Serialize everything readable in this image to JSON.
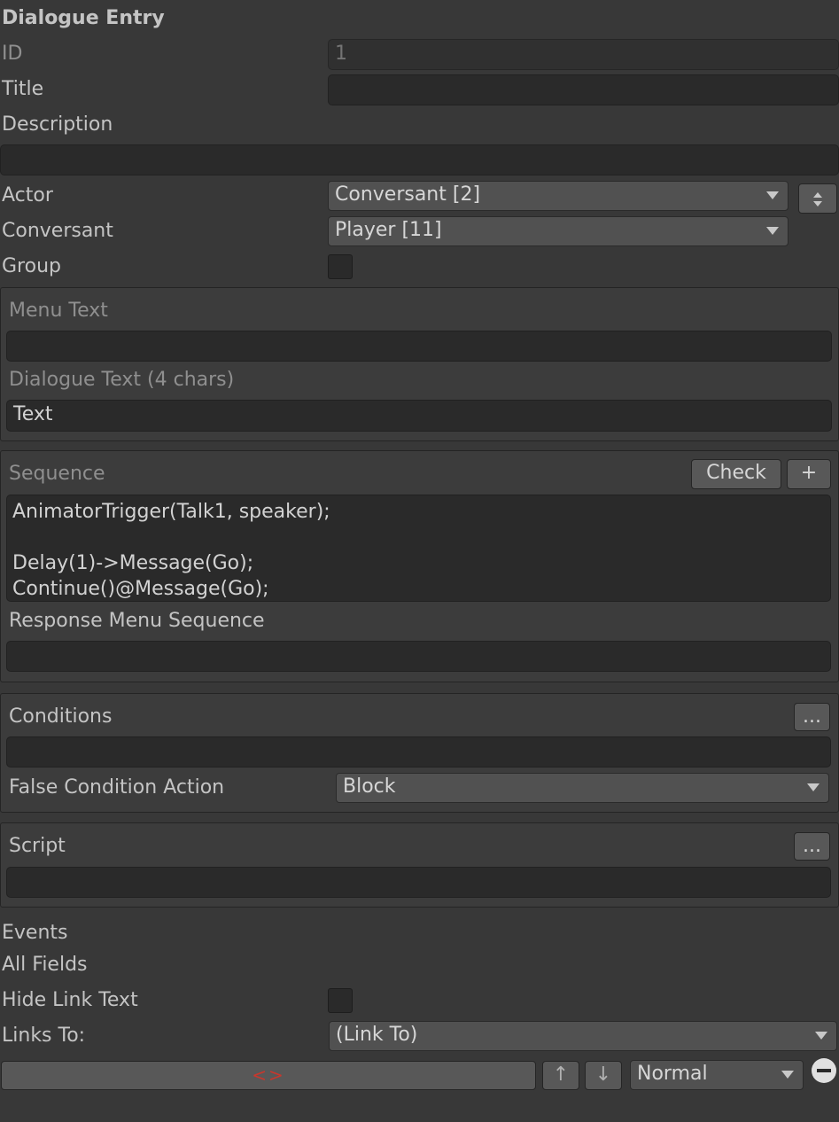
{
  "header": {
    "title": "Dialogue Entry"
  },
  "fields": {
    "id_label": "ID",
    "id_value": "1",
    "title_label": "Title",
    "title_value": "",
    "description_label": "Description",
    "description_value": "",
    "actor_label": "Actor",
    "actor_value": "Conversant [2]",
    "conversant_label": "Conversant",
    "conversant_value": "Player [11]",
    "group_label": "Group",
    "group_checked": false
  },
  "text_panel": {
    "menu_text_label": "Menu Text",
    "menu_text_value": "",
    "dialogue_text_label": "Dialogue Text (4 chars)",
    "dialogue_text_value": "Text"
  },
  "sequence_panel": {
    "sequence_label": "Sequence",
    "check_label": "Check",
    "add_label": "+",
    "sequence_value": "AnimatorTrigger(Talk1, speaker);\n\nDelay(1)->Message(Go);\nContinue()@Message(Go);",
    "response_menu_label": "Response Menu Sequence",
    "response_menu_value": ""
  },
  "conditions_panel": {
    "conditions_label": "Conditions",
    "more_label": "...",
    "conditions_value": "",
    "false_action_label": "False Condition Action",
    "false_action_value": "Block"
  },
  "script_panel": {
    "script_label": "Script",
    "more_label": "...",
    "script_value": ""
  },
  "footer": {
    "events_label": "Events",
    "all_fields_label": "All Fields",
    "hide_link_text_label": "Hide Link Text",
    "hide_link_checked": false,
    "links_to_label": "Links To:",
    "links_to_value": "(Link To)",
    "link_entry_text": "<>",
    "up_label": "↑",
    "down_label": "↓",
    "priority_value": "Normal"
  },
  "colors": {
    "link_red": "#c8372d",
    "background": "#383838"
  }
}
